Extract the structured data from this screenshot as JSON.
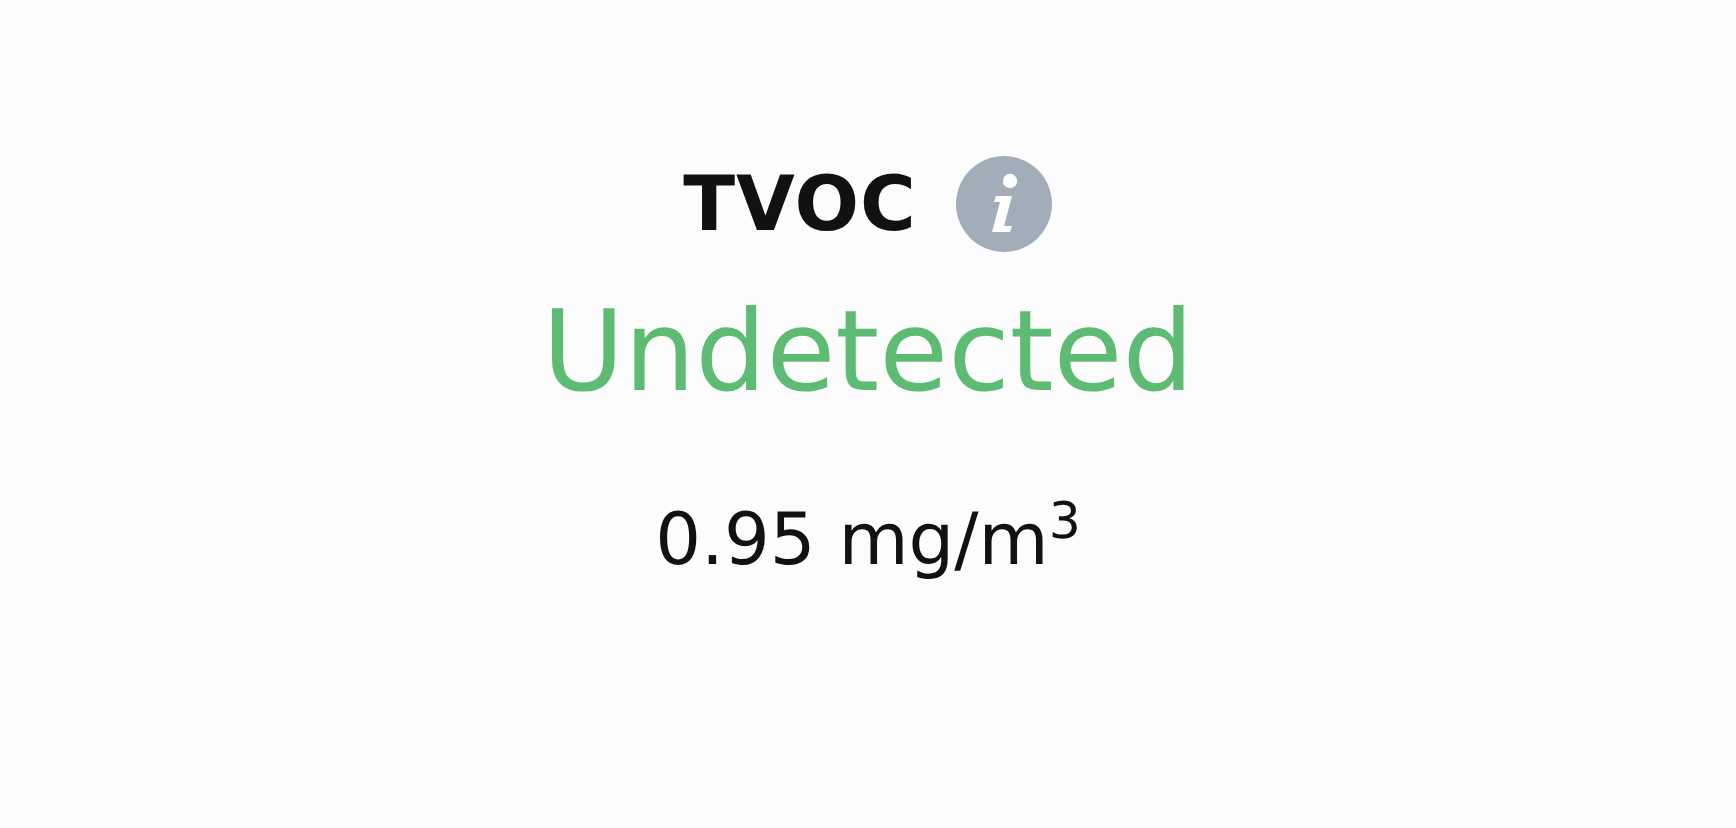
{
  "metric": {
    "title": "TVOC",
    "status": "Undetected",
    "reading": "0.95 mg/m$^{3}$"
  }
}
